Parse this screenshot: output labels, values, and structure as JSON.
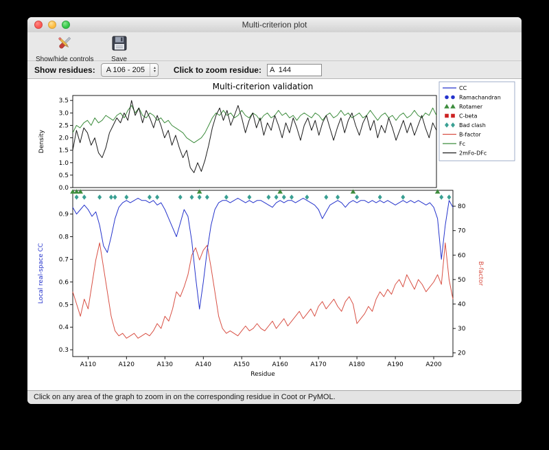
{
  "window": {
    "title": "Multi-criterion plot",
    "toolbar": {
      "show_hide_label": "Show/hide controls",
      "save_label": "Save"
    },
    "controls": {
      "show_residues_label": "Show residues:",
      "residue_range_value": "A 106 - 205",
      "zoom_residue_label": "Click to zoom residue:",
      "zoom_residue_value": "A  144"
    },
    "status_text": "Click on any area of the graph to zoom in on the corresponding residue in Coot or PyMOL."
  },
  "chart_data": {
    "type": "line",
    "title": "Multi-criterion validation",
    "x_label": "Residue",
    "x_start": 106,
    "x_end": 205,
    "x_tick_values": [
      110,
      120,
      130,
      140,
      150,
      160,
      170,
      180,
      190,
      200
    ],
    "x_tick_labels": [
      "A110",
      "A120",
      "A130",
      "A140",
      "A150",
      "A160",
      "A170",
      "A180",
      "A190",
      "A200"
    ],
    "top_plot": {
      "y_label": "Density",
      "y_ticks": [
        "0.0",
        "0.5",
        "1.0",
        "1.5",
        "2.0",
        "2.5",
        "3.0",
        "3.5"
      ],
      "y_range": [
        0,
        3.7
      ],
      "series": [
        {
          "name": "Fc",
          "color": "#3c8c3c",
          "values": [
            2.2,
            2.5,
            2.4,
            2.6,
            2.7,
            2.5,
            2.8,
            2.6,
            2.7,
            2.9,
            2.8,
            2.7,
            2.9,
            3.0,
            2.8,
            3.1,
            3.3,
            3.0,
            3.2,
            2.9,
            2.8,
            3.0,
            2.9,
            2.7,
            2.8,
            2.6,
            2.7,
            2.5,
            2.4,
            2.3,
            2.2,
            2.0,
            1.9,
            1.8,
            1.9,
            2.0,
            2.2,
            2.5,
            2.8,
            3.0,
            2.9,
            3.1,
            2.9,
            3.0,
            2.8,
            2.9,
            3.1,
            2.9,
            2.8,
            3.0,
            2.9,
            2.7,
            2.9,
            3.0,
            2.8,
            2.9,
            3.1,
            2.9,
            3.0,
            2.8,
            2.9,
            2.7,
            2.9,
            3.0,
            2.9,
            2.8,
            3.0,
            2.9,
            2.7,
            2.9,
            3.0,
            2.8,
            2.9,
            3.1,
            2.9,
            3.0,
            2.8,
            2.9,
            3.0,
            2.8,
            2.9,
            3.1,
            2.9,
            2.7,
            2.9,
            3.0,
            2.8,
            2.9,
            2.7,
            2.9,
            3.0,
            2.8,
            2.9,
            3.1,
            2.9,
            2.8,
            3.0,
            2.9,
            3.2,
            2.9
          ]
        },
        {
          "name": "2mFo-DFc",
          "color": "#1a1a1a",
          "values": [
            1.5,
            2.3,
            1.8,
            2.4,
            2.2,
            1.7,
            2.0,
            1.4,
            1.2,
            1.6,
            2.2,
            2.5,
            2.8,
            2.6,
            3.0,
            2.7,
            3.5,
            2.9,
            3.2,
            2.6,
            3.1,
            2.8,
            2.4,
            2.9,
            2.5,
            2.0,
            2.3,
            1.7,
            2.1,
            1.6,
            1.2,
            1.5,
            0.8,
            0.6,
            1.0,
            0.65,
            1.1,
            1.7,
            2.4,
            2.9,
            3.2,
            2.7,
            3.1,
            2.5,
            2.9,
            3.3,
            2.8,
            2.2,
            2.7,
            3.0,
            2.4,
            2.8,
            2.1,
            2.6,
            2.3,
            2.9,
            2.5,
            2.0,
            2.6,
            2.2,
            2.8,
            2.4,
            1.9,
            2.5,
            2.8,
            2.3,
            2.7,
            2.1,
            2.6,
            2.9,
            2.4,
            1.9,
            2.4,
            2.8,
            2.2,
            2.7,
            3.0,
            2.5,
            2.1,
            2.6,
            2.9,
            2.3,
            2.7,
            2.0,
            2.5,
            2.2,
            2.8,
            2.4,
            1.9,
            2.3,
            2.7,
            2.2,
            2.6,
            2.1,
            2.5,
            2.9,
            2.4,
            2.0,
            2.6,
            2.3
          ]
        }
      ]
    },
    "bottom_plot": {
      "y_label_left": "Local real-space CC",
      "y_label_right": "B-factor",
      "left_ticks": [
        "0.3",
        "0.4",
        "0.5",
        "0.6",
        "0.7",
        "0.8",
        "0.9"
      ],
      "left_range": [
        0.27,
        1.005
      ],
      "right_ticks": [
        20,
        30,
        40,
        50,
        60,
        70,
        80
      ],
      "right_range": [
        18.5,
        86.5
      ],
      "series": [
        {
          "name": "CC",
          "axis": "left",
          "color": "#2433cc",
          "values": [
            0.93,
            0.9,
            0.92,
            0.94,
            0.92,
            0.89,
            0.91,
            0.85,
            0.76,
            0.73,
            0.8,
            0.88,
            0.93,
            0.95,
            0.96,
            0.95,
            0.96,
            0.97,
            0.96,
            0.96,
            0.95,
            0.96,
            0.94,
            0.95,
            0.92,
            0.88,
            0.84,
            0.8,
            0.86,
            0.92,
            0.89,
            0.78,
            0.62,
            0.48,
            0.6,
            0.74,
            0.85,
            0.92,
            0.95,
            0.96,
            0.96,
            0.95,
            0.96,
            0.97,
            0.96,
            0.95,
            0.96,
            0.95,
            0.96,
            0.96,
            0.95,
            0.94,
            0.93,
            0.95,
            0.96,
            0.95,
            0.96,
            0.96,
            0.95,
            0.96,
            0.97,
            0.96,
            0.95,
            0.94,
            0.92,
            0.88,
            0.91,
            0.94,
            0.95,
            0.96,
            0.95,
            0.93,
            0.95,
            0.96,
            0.95,
            0.96,
            0.96,
            0.95,
            0.96,
            0.95,
            0.96,
            0.95,
            0.96,
            0.95,
            0.94,
            0.95,
            0.96,
            0.95,
            0.96,
            0.95,
            0.96,
            0.95,
            0.94,
            0.95,
            0.93,
            0.88,
            0.7,
            0.85,
            0.96,
            0.93
          ]
        },
        {
          "name": "B-factor",
          "axis": "right",
          "color": "#d84f43",
          "values": [
            45,
            40,
            35,
            42,
            38,
            48,
            58,
            65,
            55,
            45,
            35,
            29,
            27,
            28,
            26,
            27,
            28,
            26,
            27,
            28,
            27,
            29,
            32,
            30,
            35,
            33,
            38,
            45,
            43,
            47,
            52,
            60,
            63,
            58,
            62,
            64,
            55,
            45,
            35,
            30,
            28,
            29,
            28,
            27,
            29,
            31,
            29,
            30,
            32,
            30,
            29,
            31,
            33,
            30,
            32,
            34,
            31,
            33,
            35,
            37,
            34,
            36,
            38,
            35,
            39,
            41,
            38,
            40,
            42,
            39,
            37,
            41,
            43,
            40,
            32,
            34,
            36,
            39,
            37,
            42,
            45,
            43,
            46,
            44,
            48,
            50,
            47,
            52,
            49,
            46,
            50,
            48,
            45,
            47,
            49,
            52,
            48,
            65,
            50,
            42
          ]
        }
      ],
      "markers": [
        {
          "name": "Ramachandran",
          "shape": "circle",
          "color": "#2433cc",
          "residues": []
        },
        {
          "name": "Rotamer",
          "shape": "triangle",
          "color": "#3c8c3c",
          "residues": [
            106,
            107,
            108,
            139,
            160,
            179,
            201
          ]
        },
        {
          "name": "C-beta",
          "shape": "square",
          "color": "#cc2222",
          "residues": []
        },
        {
          "name": "Bad clash",
          "shape": "diamond",
          "color": "#3aa093",
          "residues": [
            107,
            109,
            113,
            116,
            117,
            120,
            126,
            128,
            134,
            137,
            139,
            141,
            146,
            152,
            157,
            159,
            161,
            163,
            167,
            172,
            175,
            180,
            186,
            192,
            202,
            204
          ]
        }
      ]
    },
    "legend": [
      {
        "label": "CC",
        "type": "line",
        "color": "#2433cc"
      },
      {
        "label": "Ramachandran",
        "type": "circle",
        "color": "#2433cc"
      },
      {
        "label": "Rotamer",
        "type": "triangle",
        "color": "#3c8c3c"
      },
      {
        "label": "C-beta",
        "type": "square",
        "color": "#cc2222"
      },
      {
        "label": "Bad clash",
        "type": "diamond",
        "color": "#3aa093"
      },
      {
        "label": "B-factor",
        "type": "line",
        "color": "#d84f43"
      },
      {
        "label": "Fc",
        "type": "line",
        "color": "#3c8c3c"
      },
      {
        "label": "2mFo-DFc",
        "type": "line",
        "color": "#1a1a1a"
      }
    ]
  }
}
